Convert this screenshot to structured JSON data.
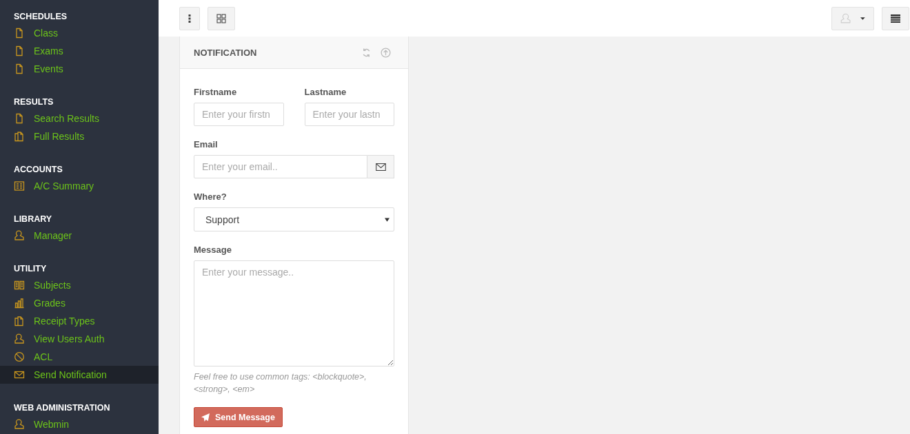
{
  "sidebar": {
    "sections": [
      {
        "title": "SCHEDULES",
        "items": [
          {
            "label": "Class",
            "kind": "file",
            "selected": false
          },
          {
            "label": "Exams",
            "kind": "file",
            "selected": false
          },
          {
            "label": "Events",
            "kind": "file",
            "selected": false
          }
        ]
      },
      {
        "title": "RESULTS",
        "items": [
          {
            "label": "Search Results",
            "kind": "file",
            "selected": false
          },
          {
            "label": "Full Results",
            "kind": "files",
            "selected": false
          }
        ]
      },
      {
        "title": "ACCOUNTS",
        "items": [
          {
            "label": "A/C Summary",
            "kind": "list",
            "selected": false
          }
        ]
      },
      {
        "title": "LIBRARY",
        "items": [
          {
            "label": "Manager",
            "kind": "user",
            "selected": false
          }
        ]
      },
      {
        "title": "UTILITY",
        "items": [
          {
            "label": "Subjects",
            "kind": "book",
            "selected": false
          },
          {
            "label": "Grades",
            "kind": "chart",
            "selected": false
          },
          {
            "label": "Receipt Types",
            "kind": "files",
            "selected": false
          },
          {
            "label": "View Users Auth",
            "kind": "user",
            "selected": false
          },
          {
            "label": "ACL",
            "kind": "ban",
            "selected": false
          },
          {
            "label": "Send Notification",
            "kind": "envelope",
            "selected": true
          }
        ]
      },
      {
        "title": "WEB ADMINISTRATION",
        "items": [
          {
            "label": "Webmin",
            "kind": "user",
            "selected": false
          }
        ]
      }
    ]
  },
  "panel": {
    "title": "NOTIFICATION",
    "firstname": {
      "label": "Firstname",
      "placeholder": "Enter your firstn"
    },
    "lastname": {
      "label": "Lastname",
      "placeholder": "Enter your lastn"
    },
    "email": {
      "label": "Email",
      "placeholder": "Enter your email.."
    },
    "where": {
      "label": "Where?",
      "value": "Support"
    },
    "message": {
      "label": "Message",
      "placeholder": "Enter your message..",
      "help": "Feel free to use common tags: <blockquote>, <strong>, <em>"
    },
    "submit": "Send Message"
  }
}
